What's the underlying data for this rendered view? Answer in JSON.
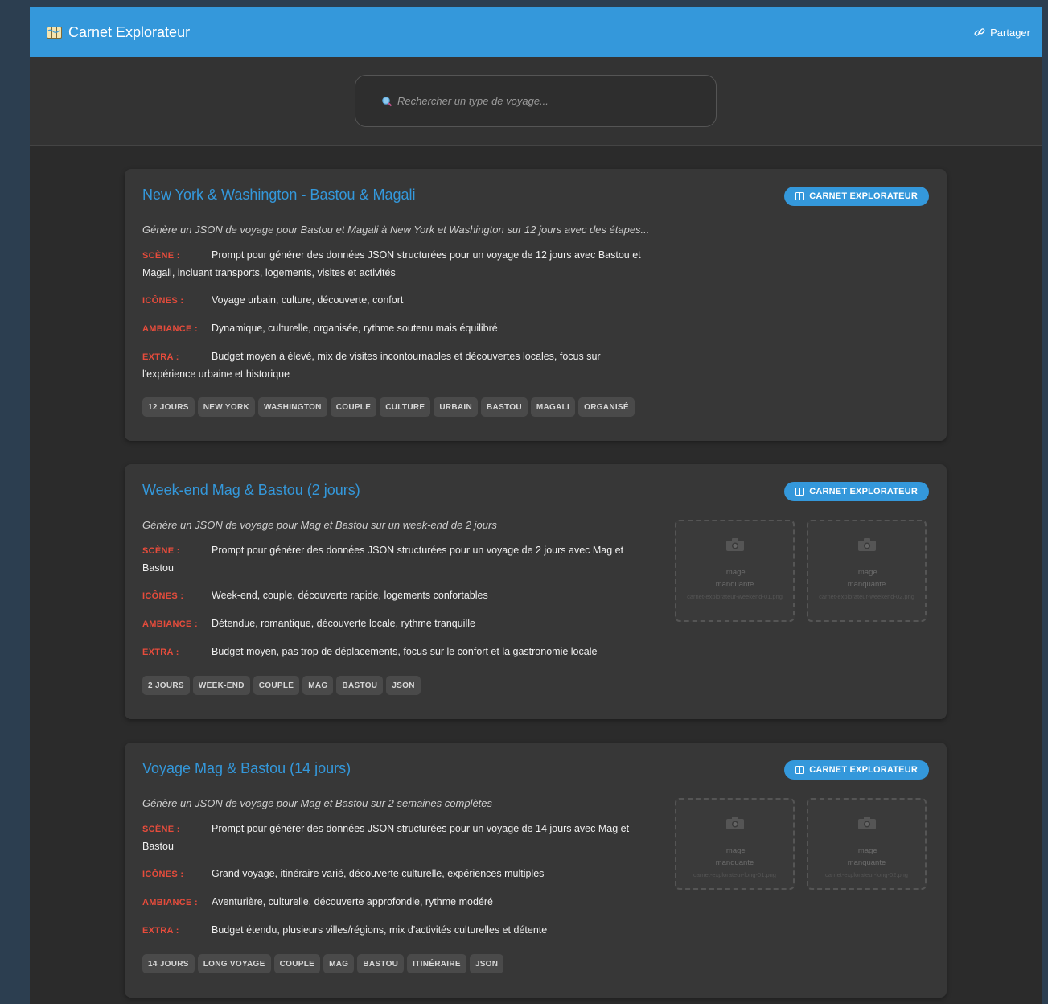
{
  "app": {
    "title": "Carnet Explorateur",
    "share_label": "Partager"
  },
  "search": {
    "placeholder": "Rechercher un type de voyage..."
  },
  "labels": {
    "scene": "SCÈNE :",
    "icones": "ICÔNES :",
    "ambiance": "AMBIANCE :",
    "extra": "EXTRA :"
  },
  "missing_image": {
    "line1": "Image",
    "line2": "manquante"
  },
  "cards": [
    {
      "title": "New York & Washington - Bastou & Magali",
      "badge": "CARNET EXPLORATEUR",
      "description": "Génère un JSON de voyage pour Bastou et Magali à New York et Washington sur 12 jours avec des étapes...",
      "scene": "Prompt pour générer des données JSON structurées pour un voyage de 12 jours avec Bastou et Magali, incluant transports, logements, visites et activités",
      "icones": "Voyage urbain, culture, découverte, confort",
      "ambiance": "Dynamique, culturelle, organisée, rythme soutenu mais équilibré",
      "extra": "Budget moyen à élevé, mix de visites incontournables et découvertes locales, focus sur l'expérience urbaine et historique",
      "tags": [
        "12 JOURS",
        "NEW YORK",
        "WASHINGTON",
        "COUPLE",
        "CULTURE",
        "URBAIN",
        "BASTOU",
        "MAGALI",
        "ORGANISÉ"
      ]
    },
    {
      "title": "Week-end Mag & Bastou (2 jours)",
      "badge": "CARNET EXPLORATEUR",
      "description": "Génère un JSON de voyage pour Mag et Bastou sur un week-end de 2 jours",
      "scene": "Prompt pour générer des données JSON structurées pour un voyage de 2 jours avec Mag et Bastou",
      "icones": "Week-end, couple, découverte rapide, logements confortables",
      "ambiance": "Détendue, romantique, découverte locale, rythme tranquille",
      "extra": "Budget moyen, pas trop de déplacements, focus sur le confort et la gastronomie locale",
      "tags": [
        "2 JOURS",
        "WEEK-END",
        "COUPLE",
        "MAG",
        "BASTOU",
        "JSON"
      ],
      "images": [
        "carnet-explorateur-weekend-01.png",
        "carnet-explorateur-weekend-02.png"
      ]
    },
    {
      "title": "Voyage Mag & Bastou (14 jours)",
      "badge": "CARNET EXPLORATEUR",
      "description": "Génère un JSON de voyage pour Mag et Bastou sur 2 semaines complètes",
      "scene": "Prompt pour générer des données JSON structurées pour un voyage de 14 jours avec Mag et Bastou",
      "icones": "Grand voyage, itinéraire varié, découverte culturelle, expériences multiples",
      "ambiance": "Aventurière, culturelle, découverte approfondie, rythme modéré",
      "extra": "Budget étendu, plusieurs villes/régions, mix d'activités culturelles et détente",
      "tags": [
        "14 JOURS",
        "LONG VOYAGE",
        "COUPLE",
        "MAG",
        "BASTOU",
        "ITINÉRAIRE",
        "JSON"
      ],
      "images": [
        "carnet-explorateur-long-01.png",
        "carnet-explorateur-long-02.png"
      ]
    }
  ]
}
